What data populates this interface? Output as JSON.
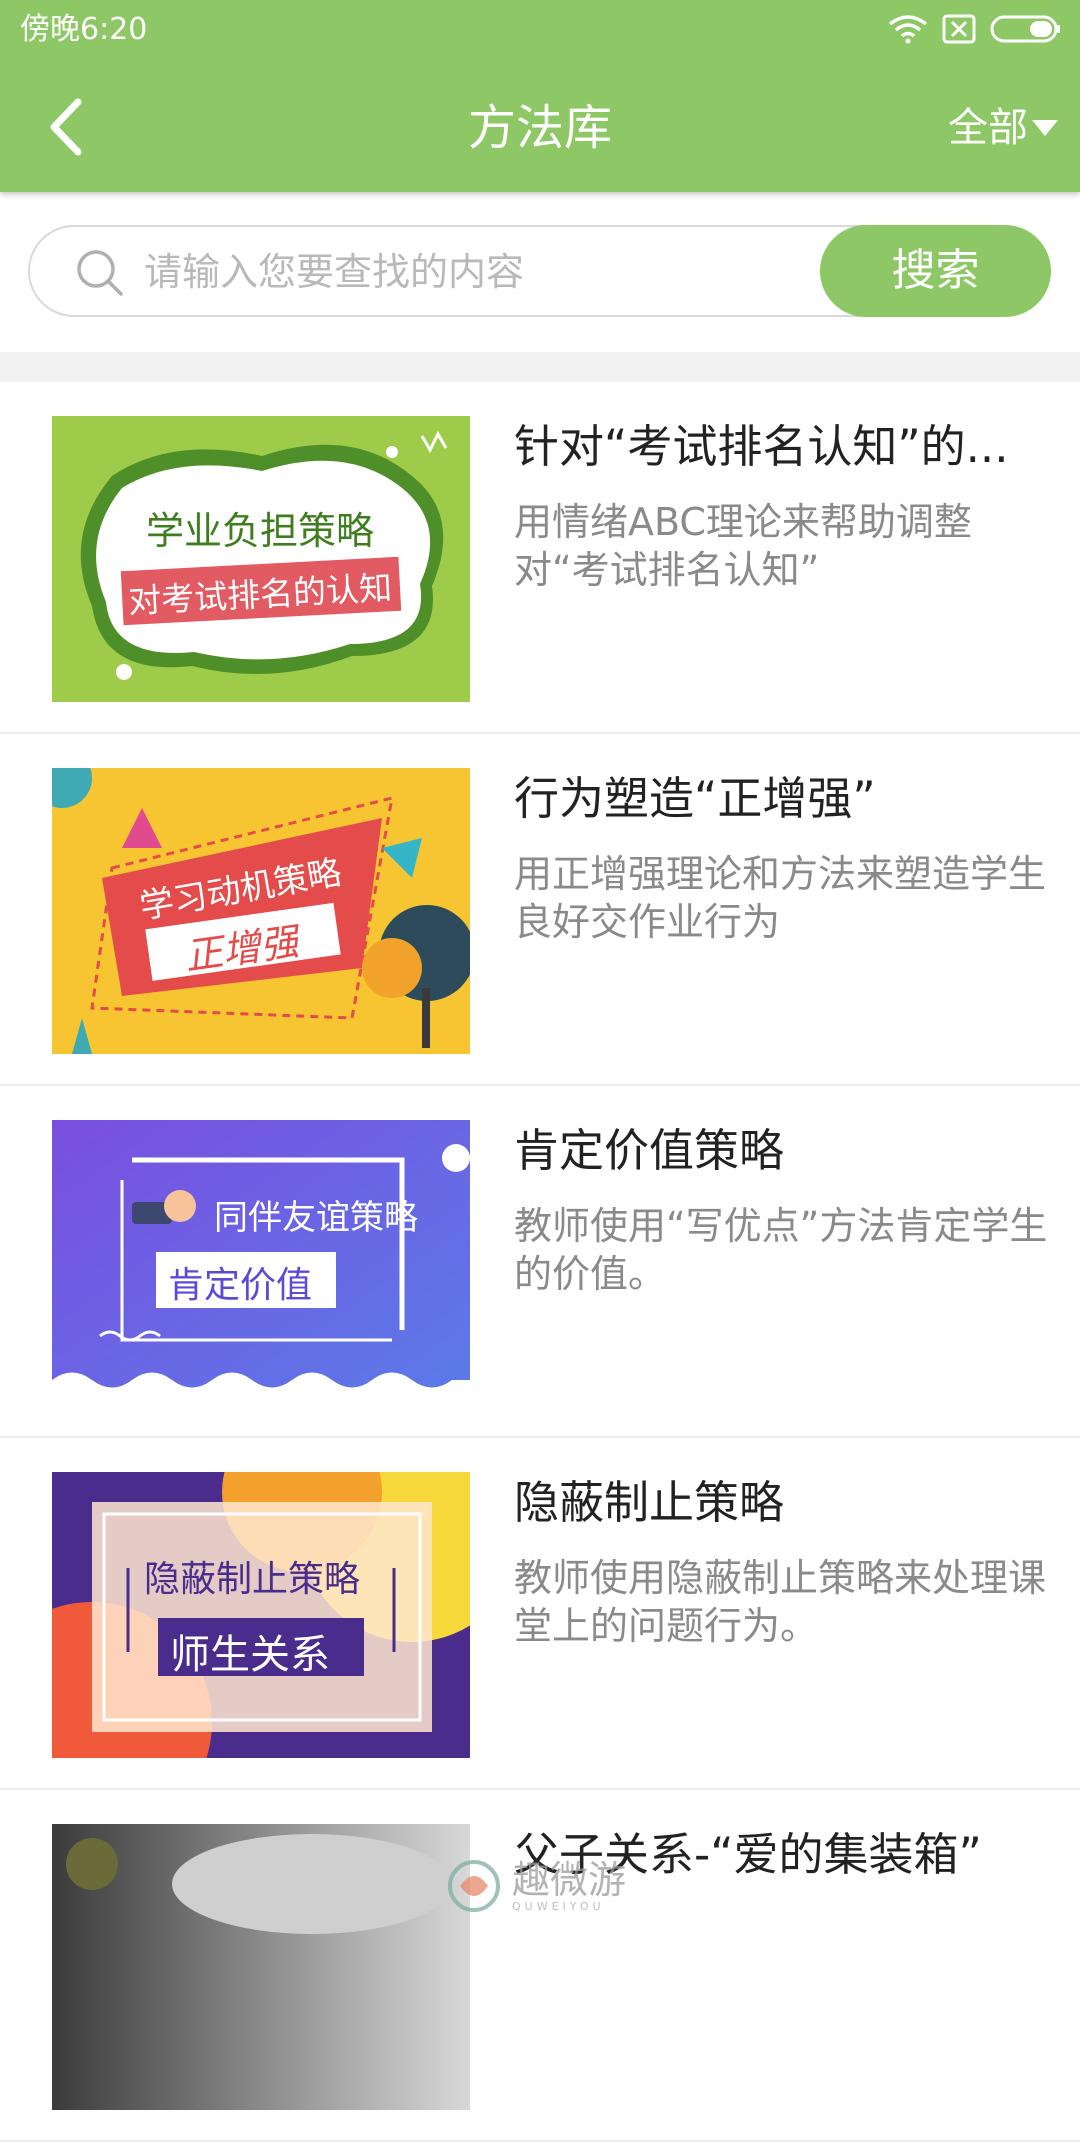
{
  "status_bar": {
    "time": "傍晚6:20"
  },
  "header": {
    "title": "方法库",
    "filter_label": "全部"
  },
  "search": {
    "placeholder": "请输入您要查找的内容",
    "button_label": "搜索"
  },
  "items": [
    {
      "title": "针对“考试排名认知”的...",
      "description": "用情绪ABC理论来帮助调整对“考试排名认知”",
      "thumb_line1": "学业负担策略",
      "thumb_line2": "对考试排名的认知"
    },
    {
      "title": "行为塑造“正增强”",
      "description": "用正增强理论和方法来塑造学生良好交作业行为",
      "thumb_line1": "学习动机策略",
      "thumb_line2": "正增强"
    },
    {
      "title": "肯定价值策略",
      "description": "教师使用“写优点”方法肯定学生的价值。",
      "thumb_line1": "同伴友谊策略",
      "thumb_line2": "肯定价值"
    },
    {
      "title": "隐蔽制止策略",
      "description": "教师使用隐蔽制止策略来处理课堂上的问题行为。",
      "thumb_line1": "隐蔽制止策略",
      "thumb_line2": "师生关系"
    },
    {
      "title": "父子关系-“爱的集装箱”",
      "description": ""
    }
  ],
  "watermark": {
    "text": "趣微游",
    "subtext": "QUWEIYOU"
  },
  "colors": {
    "brand_green": "#8ec765",
    "text_dark": "#222222",
    "text_gray": "#8a8a8a"
  }
}
